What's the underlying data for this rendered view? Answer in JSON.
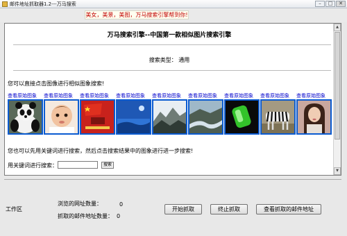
{
  "window": {
    "title": "邮件地址抓取器1.2---万马搜索",
    "controls": {
      "minimize": "–",
      "maximize": "□",
      "close": "✕"
    }
  },
  "slogan": "美女，美景，美图，万马搜索引擎帮到你!",
  "browser": {
    "page_title": "万马搜索引擎--中国第一款相似图片搜索引擎",
    "search_type": "搜索类型：  通用",
    "hint_click_image": "您可以直接点击图像进行相似图象搜索!",
    "thumbnails": [
      {
        "link": "查看原始图象",
        "icon": "panda-photo"
      },
      {
        "link": "查看原始图象",
        "icon": "baby-photo"
      },
      {
        "link": "查看原始图象",
        "icon": "flag-poster-photo"
      },
      {
        "link": "查看原始图象",
        "icon": "blue-sky-photo"
      },
      {
        "link": "查看原始图象",
        "icon": "mountain-photo"
      },
      {
        "link": "查看原始图象",
        "icon": "river-landscape-photo"
      },
      {
        "link": "查看原始图象",
        "icon": "green-object-photo"
      },
      {
        "link": "查看原始图象",
        "icon": "zebra-photo"
      },
      {
        "link": "查看原始图象",
        "icon": "woman-portrait-photo"
      }
    ],
    "hint_keyword": "您也可以先用关键词进行搜索，然后点击搜索结果中的图象进行进一步搜索!",
    "keyword_label": "用关键词进行搜索：",
    "keyword_value": "",
    "keyword_button": "搜索",
    "scroll_up": "▲",
    "scroll_down": "▼"
  },
  "status": {
    "work_area_label": "工作区",
    "visited_label": "浏览的网址数量：",
    "visited_value": "0",
    "grabbed_label": "抓取的邮件地址数量：",
    "grabbed_value": "0",
    "start_button": "开始抓取",
    "stop_button": "终止抓取",
    "view_button": "查看抓取的邮件地址"
  }
}
